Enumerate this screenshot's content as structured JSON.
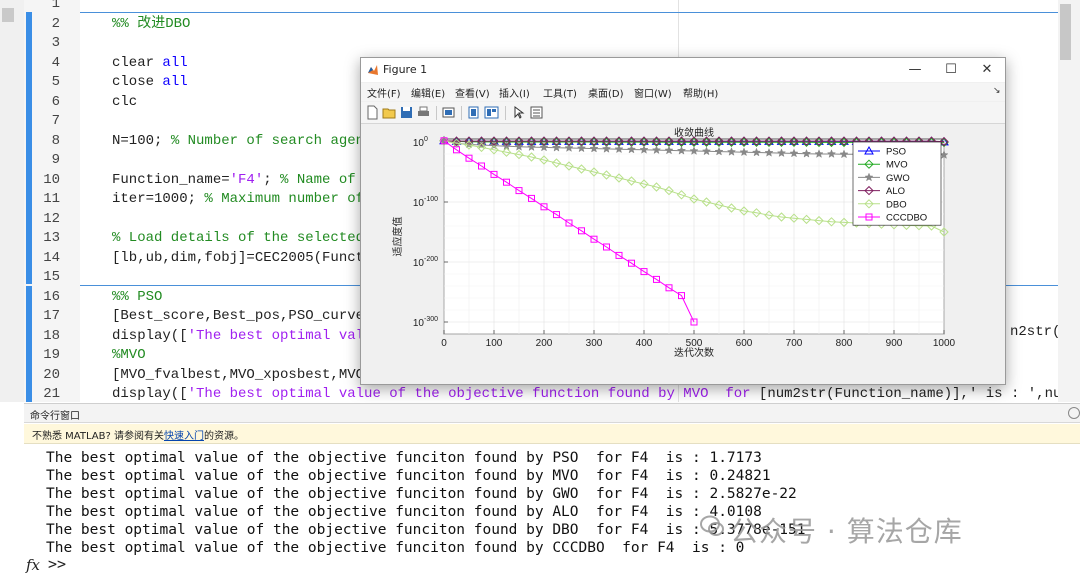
{
  "editor": {
    "lines": [
      {
        "num": "1",
        "parts": []
      },
      {
        "num": "2",
        "parts": [
          {
            "t": "cm",
            "v": "%% 改进DBO"
          }
        ]
      },
      {
        "num": "3",
        "parts": []
      },
      {
        "num": "4",
        "parts": [
          {
            "t": "",
            "v": "clear "
          },
          {
            "t": "kw",
            "v": "all"
          }
        ]
      },
      {
        "num": "5",
        "parts": [
          {
            "t": "",
            "v": "close "
          },
          {
            "t": "kw",
            "v": "all"
          }
        ]
      },
      {
        "num": "6",
        "parts": [
          {
            "t": "",
            "v": "clc"
          }
        ]
      },
      {
        "num": "7",
        "parts": []
      },
      {
        "num": "8",
        "parts": [
          {
            "t": "",
            "v": "N=100; "
          },
          {
            "t": "cm",
            "v": "% Number of search agents"
          }
        ]
      },
      {
        "num": "9",
        "parts": []
      },
      {
        "num": "10",
        "parts": [
          {
            "t": "",
            "v": "Function_name="
          },
          {
            "t": "st",
            "v": "'F4'"
          },
          {
            "t": "",
            "v": "; "
          },
          {
            "t": "cm",
            "v": "% Name of the"
          }
        ]
      },
      {
        "num": "11",
        "parts": [
          {
            "t": "",
            "v": "iter=1000; "
          },
          {
            "t": "cm",
            "v": "% Maximum number of it"
          }
        ]
      },
      {
        "num": "12",
        "parts": []
      },
      {
        "num": "13",
        "parts": [
          {
            "t": "cm",
            "v": "% Load details of the selected be"
          }
        ]
      },
      {
        "num": "14",
        "parts": [
          {
            "t": "",
            "v": "[lb,ub,dim,fobj]=CEC2005(Function"
          }
        ]
      },
      {
        "num": "15",
        "parts": []
      },
      {
        "num": "16",
        "parts": [
          {
            "t": "cm",
            "v": "%% PSO"
          }
        ]
      },
      {
        "num": "17",
        "parts": [
          {
            "t": "",
            "v": "[Best_score,Best_pos,PSO_curve]=P"
          }
        ]
      },
      {
        "num": "18",
        "parts": [
          {
            "t": "",
            "v": "display(["
          },
          {
            "t": "st",
            "v": "'The best optimal value "
          }
        ]
      },
      {
        "num": "19",
        "parts": [
          {
            "t": "cm",
            "v": "%MVO"
          }
        ]
      },
      {
        "num": "20",
        "parts": [
          {
            "t": "",
            "v": "[MVO_fvalbest,MVO_xposbest,MVO_Cu"
          }
        ]
      },
      {
        "num": "21",
        "parts": [
          {
            "t": "",
            "v": "display(["
          },
          {
            "t": "st",
            "v": "'The best optimal value of the objective function found by MVO  for "
          },
          {
            "t": "",
            "v": "[num2str(Function_name)],' is : ',num2str(MVO_"
          }
        ]
      }
    ],
    "line18_trail": "n2str(Be",
    "line21_trail": ""
  },
  "figure": {
    "title": "Figure 1",
    "menu": [
      "文件(F)",
      "编辑(E)",
      "查看(V)",
      "插入(I)",
      "工具(T)",
      "桌面(D)",
      "窗口(W)",
      "帮助(H)"
    ],
    "minimize": "—",
    "maximize": "☐",
    "close": "✕"
  },
  "chart_data": {
    "type": "line",
    "title": "收敛曲线",
    "xlabel": "迭代次数",
    "ylabel": "适应度值",
    "xlim": [
      0,
      1000
    ],
    "yscale": "log",
    "ylim_exponent": [
      -320,
      5
    ],
    "xticks": [
      "0",
      "100",
      "200",
      "300",
      "400",
      "500",
      "600",
      "700",
      "800",
      "900",
      "1000"
    ],
    "yticks": [
      {
        "base": "10",
        "exp": "0",
        "value_exp": 0
      },
      {
        "base": "10",
        "exp": "-100",
        "value_exp": -100
      },
      {
        "base": "10",
        "exp": "-200",
        "value_exp": -200
      },
      {
        "base": "10",
        "exp": "-300",
        "value_exp": -300
      }
    ],
    "grid": true,
    "legend_position": "top-right",
    "x": [
      0,
      25,
      50,
      75,
      100,
      125,
      150,
      175,
      200,
      225,
      250,
      275,
      300,
      325,
      350,
      375,
      400,
      425,
      450,
      475,
      500,
      525,
      550,
      575,
      600,
      625,
      650,
      675,
      700,
      725,
      750,
      775,
      800,
      825,
      850,
      875,
      900,
      925,
      950,
      975,
      1000
    ],
    "series": [
      {
        "name": "PSO",
        "color": "#0000ff",
        "marker": "triangle",
        "log10": [
          2,
          1,
          1,
          1,
          1,
          1,
          1,
          1,
          1,
          1,
          1,
          1,
          1,
          1,
          1,
          1,
          1,
          1,
          1,
          1,
          1,
          1,
          1,
          1,
          1,
          1,
          1,
          1,
          1,
          1,
          1,
          1,
          1,
          1,
          1,
          1,
          1,
          1,
          1,
          1,
          0.2
        ]
      },
      {
        "name": "MVO",
        "color": "#22aa22",
        "marker": "diamond",
        "log10": [
          2,
          1,
          0.5,
          0.3,
          0.2,
          0.1,
          0,
          0,
          0,
          0,
          0,
          0,
          -0.1,
          -0.2,
          -0.2,
          -0.3,
          -0.3,
          -0.3,
          -0.4,
          -0.4,
          -0.4,
          -0.4,
          -0.5,
          -0.5,
          -0.5,
          -0.5,
          -0.5,
          -0.5,
          -0.5,
          -0.5,
          -0.6,
          -0.6,
          -0.6,
          -0.6,
          -0.6,
          -0.6,
          -0.6,
          -0.6,
          -0.6,
          -0.6,
          -0.6
        ]
      },
      {
        "name": "GWO",
        "color": "#888888",
        "marker": "star",
        "log10": [
          2,
          -2,
          -4,
          -5,
          -6,
          -7,
          -8,
          -8.5,
          -9,
          -9.5,
          -10,
          -10.5,
          -11,
          -11.5,
          -12,
          -12.5,
          -13,
          -13.5,
          -14,
          -14.5,
          -15,
          -15.5,
          -16,
          -16.5,
          -17,
          -17.5,
          -18,
          -18.5,
          -19,
          -19.5,
          -20,
          -20,
          -20.5,
          -20.5,
          -21,
          -21,
          -21.5,
          -21.5,
          -21.6,
          -21.6,
          -21.6
        ]
      },
      {
        "name": "ALO",
        "color": "#7f1f5f",
        "marker": "diamond",
        "log10": [
          2,
          1.5,
          1.5,
          1.5,
          1.5,
          1.5,
          1.5,
          1.5,
          1.5,
          1.5,
          1.5,
          1.5,
          1.5,
          1.5,
          1.5,
          1.5,
          1.5,
          1.5,
          1.5,
          1.5,
          1.5,
          1.5,
          1.5,
          1.5,
          1.5,
          1.5,
          1.5,
          1.5,
          1.5,
          1.5,
          1.5,
          1.5,
          1.5,
          1.5,
          1.5,
          1.5,
          1.5,
          1.5,
          1.5,
          1.5,
          0.6
        ]
      },
      {
        "name": "DBO",
        "color": "#b8e08a",
        "marker": "diamond",
        "log10": [
          2,
          -2,
          -5,
          -9,
          -13,
          -17,
          -21,
          -25,
          -30,
          -35,
          -40,
          -45,
          -50,
          -55,
          -60,
          -65,
          -70,
          -75,
          -81,
          -88,
          -95,
          -100,
          -105,
          -110,
          -115,
          -118,
          -122,
          -125,
          -127,
          -129,
          -131,
          -133,
          -134,
          -135,
          -136,
          -137,
          -138,
          -139,
          -139.5,
          -140,
          -150
        ]
      },
      {
        "name": "CCCDBO",
        "color": "#ff00ff",
        "marker": "square",
        "log10": [
          2,
          -13,
          -27,
          -40,
          -54,
          -67,
          -81,
          -94,
          -108,
          -121,
          -135,
          -148,
          -162,
          -175,
          -189,
          -202,
          -216,
          -229,
          -243,
          -256,
          -300
        ]
      }
    ]
  },
  "command_window": {
    "header": "命令行窗口",
    "notice_prefix": "不熟悉 MATLAB? 请参阅有关",
    "notice_link": "快速入门",
    "notice_suffix": "的资源。",
    "output": [
      "The best optimal value of the objective funciton found by PSO  for F4  is : 1.7173",
      "The best optimal value of the objective funciton found by MVO  for F4  is : 0.24821",
      "The best optimal value of the objective funciton found by GWO  for F4  is : 2.5827e-22",
      "The best optimal value of the objective funciton found by ALO  for F4  is : 4.0108",
      "The best optimal value of the objective funciton found by DBO  for F4  is : 5.3778e-151",
      "The best optimal value of the objective funciton found by CCCDBO  for F4  is : 0"
    ],
    "prompt_fx": "fx",
    "prompt": ">>"
  },
  "watermark": "公众号 · 算法仓库"
}
